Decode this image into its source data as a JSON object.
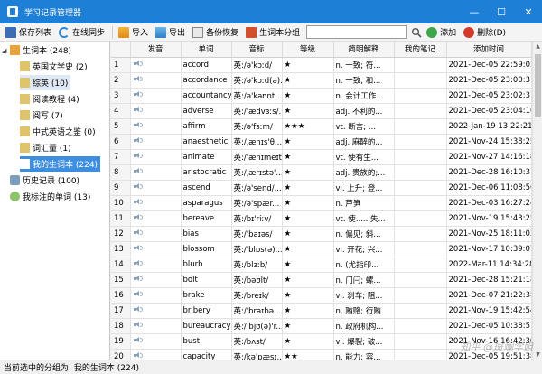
{
  "window": {
    "title": "学习记录管理器",
    "controls": [
      "—",
      "☐",
      "✕"
    ]
  },
  "toolbar": {
    "buttons": [
      "保存列表",
      "在线同步",
      "导入",
      "导出",
      "备份恢复",
      "生词本分组",
      "添加",
      "删除(D)"
    ],
    "search_placeholder": ""
  },
  "sidebar": {
    "items": [
      {
        "label": "生词本 (248)",
        "level": 0
      },
      {
        "label": "英国文学史 (2)",
        "level": 1
      },
      {
        "label": "综英 (10)",
        "level": 1
      },
      {
        "label": "阅读教程 (4)",
        "level": 1
      },
      {
        "label": "阅写 (7)",
        "level": 1
      },
      {
        "label": "中式英语之鉴 (0)",
        "level": 1
      },
      {
        "label": "词汇量 (1)",
        "level": 1
      },
      {
        "label": "我的生词本 (224)",
        "level": 1
      },
      {
        "label": "历史记录 (100)",
        "level": 0
      },
      {
        "label": "我标注的单词 (13)",
        "level": 0
      }
    ]
  },
  "table": {
    "headers": [
      "",
      "发音",
      "单词",
      "音标",
      "等级",
      "简明解释",
      "我的笔记",
      "添加时间"
    ],
    "rows": [
      {
        "n": "1",
        "word": "accord",
        "ipa": "英:/ə'kɔːd/",
        "level": "★",
        "def": "n. 一致; 符...",
        "note": "",
        "time": "2021-Dec-05 22:59:05"
      },
      {
        "n": "2",
        "word": "accordance",
        "ipa": "英:/ə'kɔːd(ə)...",
        "level": "★",
        "def": "n. 一致, 和...",
        "note": "",
        "time": "2021-Dec-05 23:00:31"
      },
      {
        "n": "3",
        "word": "accountancy",
        "ipa": "英:/ə'kaʊnt...",
        "level": "★",
        "def": "n. 会计工作...",
        "note": "",
        "time": "2021-Dec-05 23:02:37"
      },
      {
        "n": "4",
        "word": "adverse",
        "ipa": "英:/'ædvɜːs/...",
        "level": "★",
        "def": "adj. 不利的...",
        "note": "",
        "time": "2021-Dec-05 23:04:10"
      },
      {
        "n": "5",
        "word": "affirm",
        "ipa": "英:/ə'fɜːm/",
        "level": "★★★",
        "def": "vt. 断言; ...",
        "note": "",
        "time": "2022-Jan-19 13:22:21"
      },
      {
        "n": "6",
        "word": "anaesthetic",
        "ipa": "英:/ˌænɪs'θ...",
        "level": "★",
        "def": "adj. 麻醉的...",
        "note": "",
        "time": "2021-Nov-24 15:38:25"
      },
      {
        "n": "7",
        "word": "animate",
        "ipa": "英:/'ænɪmeɪt...",
        "level": "★",
        "def": "vt. 使有生...",
        "note": "",
        "time": "2021-Nov-27 14:16:18"
      },
      {
        "n": "8",
        "word": "aristocratic",
        "ipa": "英:/ˌærɪstə'...",
        "level": "★",
        "def": "adj. 贵族的;...",
        "note": "",
        "time": "2021-Dec-28 16:10:31"
      },
      {
        "n": "9",
        "word": "ascend",
        "ipa": "英:/ə'send/...",
        "level": "★",
        "def": "vi. 上升; 登...",
        "note": "",
        "time": "2021-Dec-06 11:08:56"
      },
      {
        "n": "10",
        "word": "asparagus",
        "ipa": "英:/ə'spær...",
        "level": "★",
        "def": "n. 芦笋",
        "note": "",
        "time": "2021-Dec-03 16:27:24"
      },
      {
        "n": "11",
        "word": "bereave",
        "ipa": "英:/bɪ'riːv/",
        "level": "★",
        "def": "vt. 使......失...",
        "note": "",
        "time": "2021-Nov-19 15:43:25"
      },
      {
        "n": "12",
        "word": "bias",
        "ipa": "英:/'baɪəs/",
        "level": "★",
        "def": "n. 偏见; 斜...",
        "note": "",
        "time": "2021-Nov-25 18:11:03"
      },
      {
        "n": "13",
        "word": "blossom",
        "ipa": "英:/'blɒs(ə)...",
        "level": "★",
        "def": "vi. 开花; 兴...",
        "note": "",
        "time": "2021-Nov-17 10:39:07"
      },
      {
        "n": "14",
        "word": "blurb",
        "ipa": "英:/blɜːb/",
        "level": "★",
        "def": "n. (尤指印...",
        "note": "",
        "time": "2022-Mar-11 14:34:28"
      },
      {
        "n": "15",
        "word": "bolt",
        "ipa": "英:/bəʊlt/",
        "level": "★",
        "def": "n. 门闩; 螺...",
        "note": "",
        "time": "2021-Dec-28 15:21:18"
      },
      {
        "n": "16",
        "word": "brake",
        "ipa": "英:/breɪk/",
        "level": "★",
        "def": "vi. 刹车; 阻...",
        "note": "",
        "time": "2021-Dec-07 21:22:38"
      },
      {
        "n": "17",
        "word": "bribery",
        "ipa": "英:/'braɪbə...",
        "level": "★",
        "def": "n. 贿赂; 行贿",
        "note": "",
        "time": "2021-Nov-19 15:42:54"
      },
      {
        "n": "18",
        "word": "bureaucracy",
        "ipa": "英:/ bjʊ(ə)'r...",
        "level": "★",
        "def": "n. 政府机构...",
        "note": "",
        "time": "2021-Dec-05 10:38:57"
      },
      {
        "n": "19",
        "word": "bust",
        "ipa": "英:/bʌst/",
        "level": "★",
        "def": "vi. 爆裂; 破...",
        "note": "",
        "time": "2021-Nov-16 16:42:30"
      },
      {
        "n": "20",
        "word": "capacity",
        "ipa": "英:/kə'pæsɪ...",
        "level": "★★",
        "def": "n. 能力; 容...",
        "note": "",
        "time": "2021-Dec-05 19:51:38"
      }
    ]
  },
  "status": {
    "text": "当前选中的分组为: 我的生词本 (224)"
  },
  "watermark": "知乎 @斑斓学姐"
}
